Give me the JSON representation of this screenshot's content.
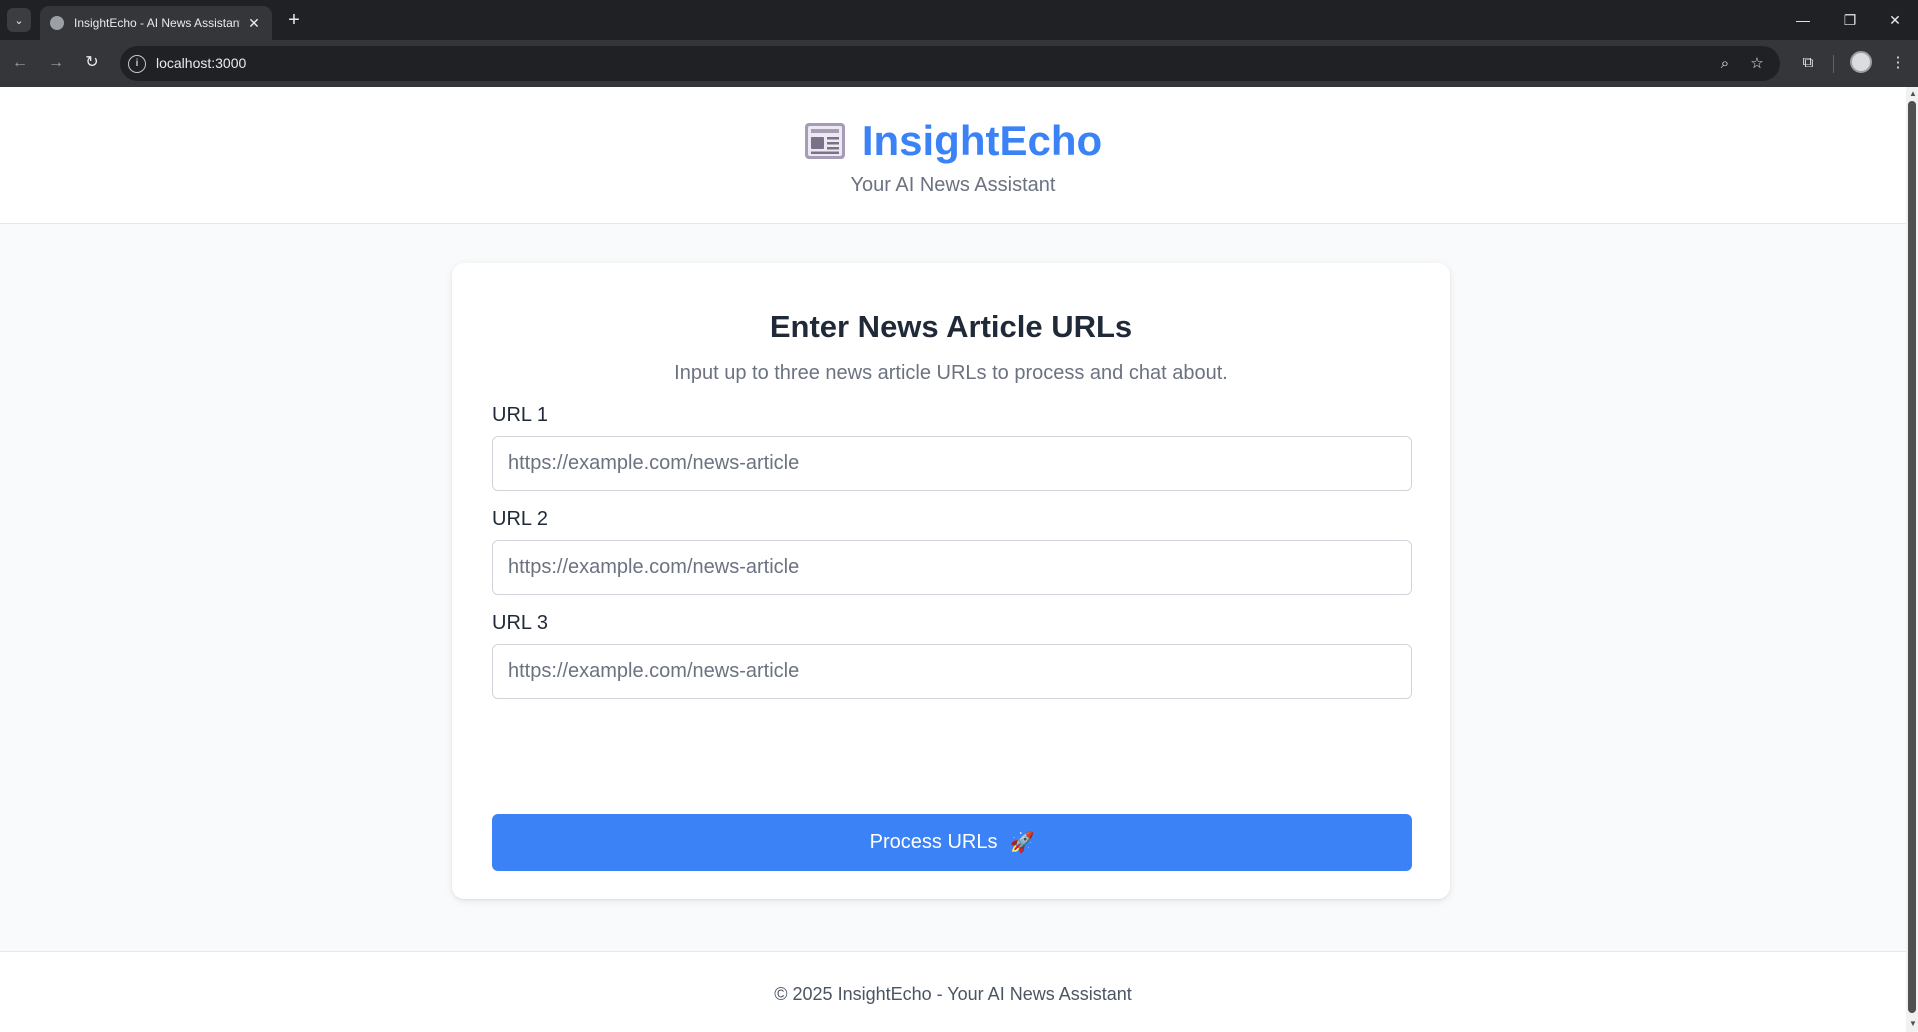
{
  "browser": {
    "tab_title": "InsightEcho - AI News Assistant",
    "tab_close": "✕",
    "new_tab": "+",
    "url": "localhost:3000",
    "tab_dropdown": "⌄",
    "win_minimize": "—",
    "win_restore": "❐",
    "win_close": "✕",
    "back": "←",
    "forward": "→",
    "reload": "↻",
    "zoom_icon": "⌕",
    "bookmark_icon": "☆",
    "extensions_icon": "⧉",
    "menu_icon": "⋮"
  },
  "header": {
    "brand": "InsightEcho",
    "tagline": "Your AI News Assistant",
    "logo_icon": "newspaper-icon"
  },
  "form": {
    "title": "Enter News Article URLs",
    "subtitle": "Input up to three news article URLs to process and chat about.",
    "fields": [
      {
        "label": "URL 1",
        "value": "",
        "placeholder": "https://example.com/news-article"
      },
      {
        "label": "URL 2",
        "value": "",
        "placeholder": "https://example.com/news-article"
      },
      {
        "label": "URL 3",
        "value": "",
        "placeholder": "https://example.com/news-article"
      }
    ],
    "submit_label": "Process URLs",
    "submit_icon": "🚀"
  },
  "footer": {
    "text": "© 2025 InsightEcho - Your AI News Assistant"
  },
  "colors": {
    "accent": "#3b82f6",
    "page_bg": "#f9fafb",
    "heading": "#1f2937",
    "muted": "#6b7280"
  }
}
